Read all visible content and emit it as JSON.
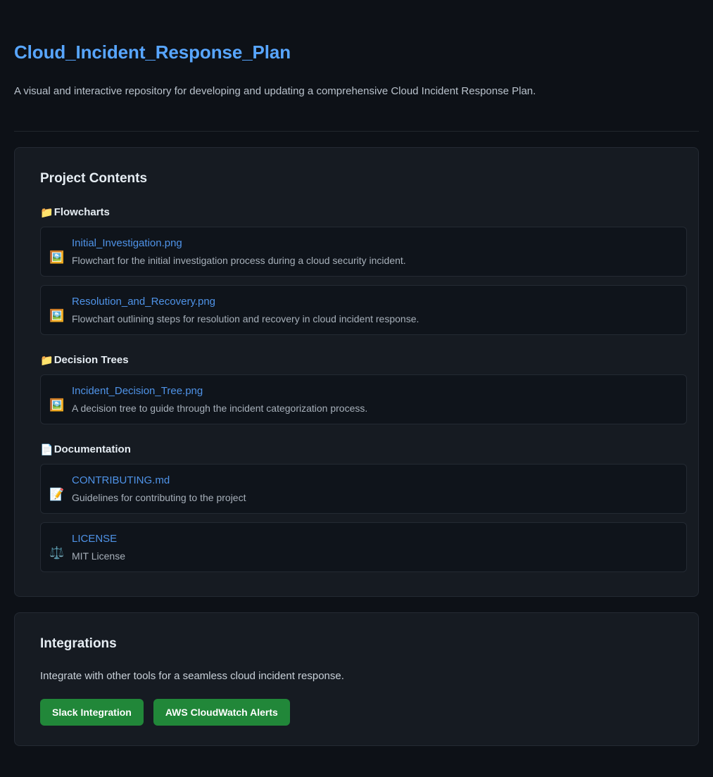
{
  "header": {
    "title": "Cloud_Incident_Response_Plan",
    "subtitle": "A visual and interactive repository for developing and updating a comprehensive Cloud Incident Response Plan."
  },
  "contents": {
    "title": "Project Contents",
    "groups": [
      {
        "icon": "folder-icon",
        "icon_glyph": "📁",
        "label": "Flowcharts",
        "files": [
          {
            "icon": "picture-icon",
            "icon_glyph": "🖼️",
            "name": "Initial_Investigation.png",
            "description": "Flowchart for the initial investigation process during a cloud security incident."
          },
          {
            "icon": "picture-icon",
            "icon_glyph": "🖼️",
            "name": "Resolution_and_Recovery.png",
            "description": "Flowchart outlining steps for resolution and recovery in cloud incident response."
          }
        ]
      },
      {
        "icon": "folder-icon",
        "icon_glyph": "📁",
        "label": "Decision Trees",
        "files": [
          {
            "icon": "picture-icon",
            "icon_glyph": "🖼️",
            "name": "Incident_Decision_Tree.png",
            "description": "A decision tree to guide through the incident categorization process."
          }
        ]
      },
      {
        "icon": "document-icon",
        "icon_glyph": "📄",
        "label": "Documentation",
        "files": [
          {
            "icon": "memo-icon",
            "icon_glyph": "📝",
            "name": "CONTRIBUTING.md",
            "description": "Guidelines for contributing to the project"
          },
          {
            "icon": "balance-scale-icon",
            "icon_glyph": "⚖️",
            "name": "LICENSE",
            "description": "MIT License"
          }
        ]
      }
    ]
  },
  "integrations": {
    "title": "Integrations",
    "description": "Integrate with other tools for a seamless cloud incident response.",
    "buttons": [
      {
        "label": "Slack Integration"
      },
      {
        "label": "AWS CloudWatch Alerts"
      }
    ]
  },
  "colors": {
    "page_background": "#0d1117",
    "panel_background": "#161b22",
    "card_background": "#0f141b",
    "border": "#242a33",
    "link": "#4f93e8",
    "title_accent": "#58a6ff",
    "button_green": "#218739",
    "text_primary": "#e6edf3",
    "text_secondary": "#a7b0ba"
  }
}
